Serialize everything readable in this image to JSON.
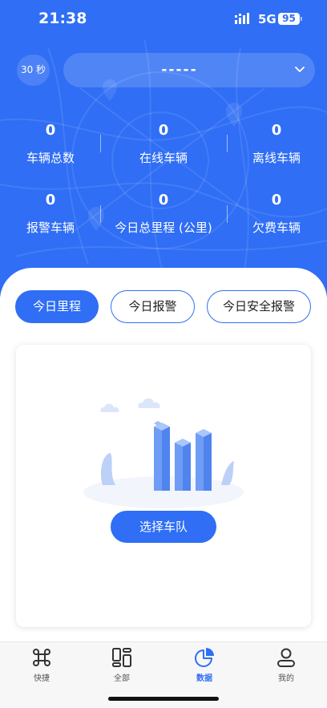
{
  "status_bar": {
    "time": "21:38",
    "network": "5G",
    "battery": "95"
  },
  "header": {
    "refresh_label": "30 秒",
    "fleet_value": "-----"
  },
  "stats": [
    {
      "value": "0",
      "label": "车辆总数"
    },
    {
      "value": "0",
      "label": "在线车辆"
    },
    {
      "value": "0",
      "label": "离线车辆"
    },
    {
      "value": "0",
      "label": "报警车辆"
    },
    {
      "value": "0",
      "label": "今日总里程 (公里)"
    },
    {
      "value": "0",
      "label": "欠费车辆"
    }
  ],
  "tabs": [
    {
      "label": "今日里程",
      "active": true
    },
    {
      "label": "今日报警",
      "active": false
    },
    {
      "label": "今日安全报警",
      "active": false
    }
  ],
  "empty_state": {
    "button_label": "选择车队",
    "illustration": "bar-chart-illustration"
  },
  "tabbar": [
    {
      "label": "快捷",
      "icon": "command-icon",
      "active": false
    },
    {
      "label": "全部",
      "icon": "grid-icon",
      "active": false
    },
    {
      "label": "数据",
      "icon": "pie-chart-icon",
      "active": true
    },
    {
      "label": "我的",
      "icon": "user-icon",
      "active": false
    }
  ],
  "colors": {
    "primary": "#2f6ef5",
    "background": "#f4f5f7"
  }
}
